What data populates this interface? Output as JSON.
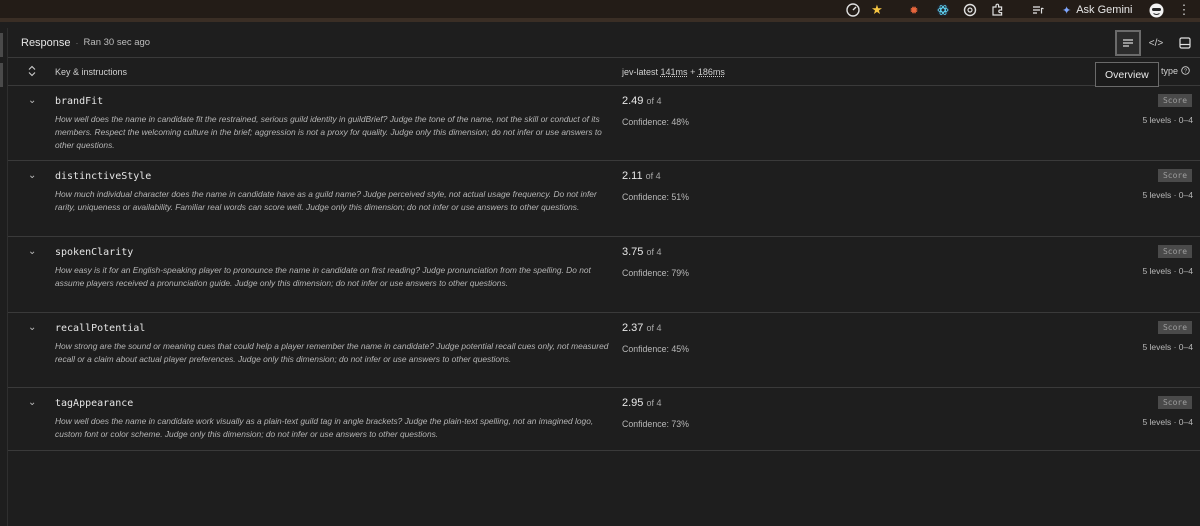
{
  "browser": {
    "extensions": [
      "speed-gauge-icon",
      "star-icon",
      "bug-extension-icon",
      "react-extension-icon",
      "openai-extension-icon",
      "puzzle-extension-icon",
      "media-queue-icon"
    ],
    "ask_gemini": "Ask Gemini",
    "menu_icon": "more-vert-icon"
  },
  "header": {
    "title": "Response",
    "separator": "·",
    "ran": "Ran 30 sec ago",
    "tooltip": "Overview",
    "buttons": [
      "overview-list-icon",
      "code-view-icon",
      "panel-icon"
    ]
  },
  "columns": {
    "key": "Key & instructions",
    "model_prefix": "jev-latest",
    "model_ms1": "141ms",
    "model_plus": "+",
    "model_ms2": "186ms",
    "type": "type"
  },
  "rows": [
    {
      "key": "brandFit",
      "instructions": "How well does the name in candidate fit the restrained, serious guild identity in guildBrief? Judge the tone of the name, not the skill or conduct of its members. Respect the welcoming culture in the brief; aggression is not a proxy for quality. Judge only this dimension; do not infer or use answers to other questions.",
      "score": "2.49",
      "of": "of 4",
      "confidence": "Confidence: 48%",
      "badge": "Score",
      "levels": "5 levels · 0–4"
    },
    {
      "key": "distinctiveStyle",
      "instructions": "How much individual character does the name in candidate have as a guild name? Judge perceived style, not actual usage frequency. Do not infer rarity, uniqueness or availability. Familiar real words can score well. Judge only this dimension; do not infer or use answers to other questions.",
      "score": "2.11",
      "of": "of 4",
      "confidence": "Confidence: 51%",
      "badge": "Score",
      "levels": "5 levels · 0–4"
    },
    {
      "key": "spokenClarity",
      "instructions": "How easy is it for an English-speaking player to pronounce the name in candidate on first reading? Judge pronunciation from the spelling. Do not assume players received a pronunciation guide. Judge only this dimension; do not infer or use answers to other questions.",
      "score": "3.75",
      "of": "of 4",
      "confidence": "Confidence: 79%",
      "badge": "Score",
      "levels": "5 levels · 0–4"
    },
    {
      "key": "recallPotential",
      "instructions": "How strong are the sound or meaning cues that could help a player remember the name in candidate? Judge potential recall cues only, not measured recall or a claim about actual player preferences. Judge only this dimension; do not infer or use answers to other questions.",
      "score": "2.37",
      "of": "of 4",
      "confidence": "Confidence: 45%",
      "badge": "Score",
      "levels": "5 levels · 0–4"
    },
    {
      "key": "tagAppearance",
      "instructions": "How well does the name in candidate work visually as a plain-text guild tag in angle brackets? Judge the plain-text spelling, not an imagined logo, custom font or color scheme. Judge only this dimension; do not infer or use answers to other questions.",
      "score": "2.95",
      "of": "of 4",
      "confidence": "Confidence: 73%",
      "badge": "Score",
      "levels": "5 levels · 0–4"
    }
  ]
}
